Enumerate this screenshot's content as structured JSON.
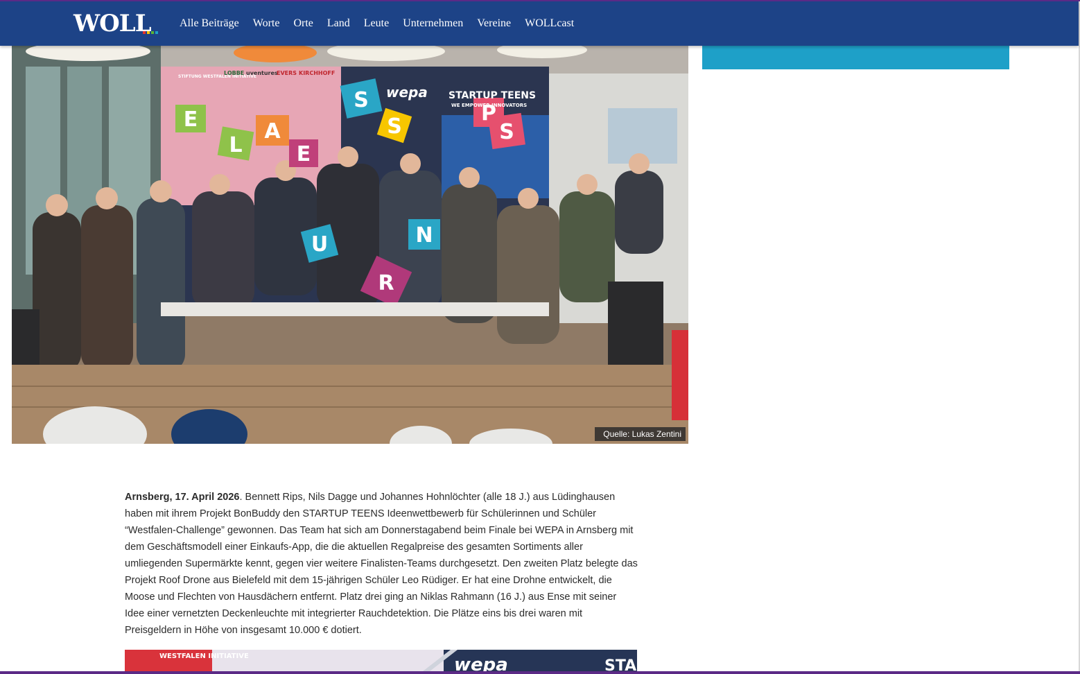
{
  "header": {
    "logo": "WOLL",
    "nav": [
      "Alle Beiträge",
      "Worte",
      "Orte",
      "Land",
      "Leute",
      "Unternehmen",
      "Vereine",
      "WOLLcast"
    ]
  },
  "hero": {
    "caption": "Quelle: Lukas Zentini",
    "sign_lettering": [
      "STARTUP TEENS",
      "WE EMPOWER INNOVATORS",
      "STIFTUNG WESTFALEN INITIATIVE",
      "LOBBE",
      "uventures",
      "EVERS",
      "KIRCHHOFF",
      "wepa"
    ],
    "cube_letters": [
      "S",
      "E",
      "L",
      "A",
      "E",
      "S",
      "P",
      "S",
      "N",
      "U",
      "R"
    ]
  },
  "article": {
    "dateline": "Arnsberg, 17. April 2026",
    "body": ". Bennett Rips, Nils Dagge und Johannes Hohnlöchter (alle 18 J.) aus Lüdinghausen haben mit ihrem Projekt BonBuddy den STARTUP TEENS Ideenwettbewerb für Schülerinnen und Schüler “Westfalen-Challenge” gewonnen. Das Team hat sich am Donnerstagabend beim Finale bei WEPA in Arnsberg mit dem Geschäftsmodell einer Einkaufs-App, die die aktuellen Regalpreise des gesamten Sortiments aller umliegenden Supermärkte kennt, gegen vier weitere Finalisten-Teams durchgesetzt. Den zweiten Platz belegte das Projekt Roof Drone aus Bielefeld mit dem 15-jährigen Schüler Leo Rüdiger. Er hat eine Drohne entwickelt, die Moose und Flechten von Hausdächern entfernt. Platz drei ging an Niklas Rahmann (16 J.) aus Ense mit seiner Idee einer vernetzten Deckenleuchte mit integrierter Rauchdetektion. Die Plätze eins bis drei waren mit Preisgeldern in Höhe von insgesamt 10.000 € dotiert."
  },
  "second_photo": {
    "lettering": [
      "WESTFALEN INITIATIVE",
      "wepa",
      "STA"
    ]
  },
  "colors": {
    "header_bg": "#1d4387",
    "sidebar_block": "#1ea0c8",
    "edge": "#5b2a86"
  }
}
